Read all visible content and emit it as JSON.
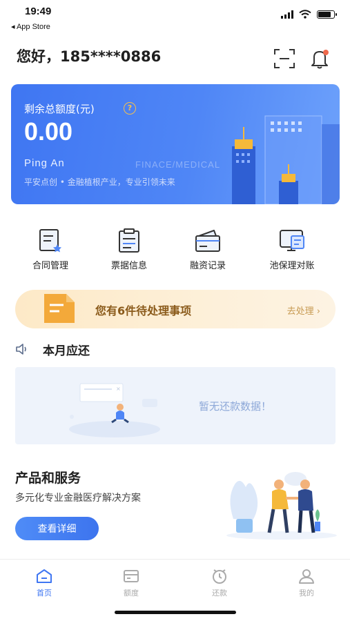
{
  "status_bar": {
    "time": "19:49",
    "back_label": "◂ App Store"
  },
  "header": {
    "greeting": "您好，185****0886",
    "scan_icon": "scan-icon",
    "bell_icon": "bell-icon"
  },
  "balance_card": {
    "label": "剩余总额度(元)",
    "help_glyph": "?",
    "amount": "0.00",
    "brand": "Ping An",
    "watermark": "FINACE/MEDICAL",
    "slogan": "平安点创 • 金融植根产业，专业引领未来"
  },
  "quick_menu": [
    {
      "label": "合同管理",
      "icon": "contract-icon"
    },
    {
      "label": "票据信息",
      "icon": "bill-icon"
    },
    {
      "label": "融资记录",
      "icon": "financing-record-icon"
    },
    {
      "label": "池保理对账",
      "icon": "reconcile-icon"
    }
  ],
  "todo": {
    "text": "您有6件待处理事项",
    "action": "去处理 ›"
  },
  "repayment": {
    "title": "本月应还",
    "empty_text": "暂无还款数据！"
  },
  "products": {
    "title": "产品和服务",
    "subtitle": "多元化专业金融医疗解决方案",
    "button": "查看详细"
  },
  "tab_bar": [
    {
      "label": "首页",
      "icon": "home-icon",
      "active": true
    },
    {
      "label": "额度",
      "icon": "card-icon",
      "active": false
    },
    {
      "label": "还款",
      "icon": "clock-icon",
      "active": false
    },
    {
      "label": "我的",
      "icon": "user-icon",
      "active": false
    }
  ],
  "colors": {
    "primary": "#3f76f2",
    "accent_gold": "#f5c04d",
    "todo_text": "#8a5a1a",
    "inactive_tab": "#aaaaaa"
  }
}
